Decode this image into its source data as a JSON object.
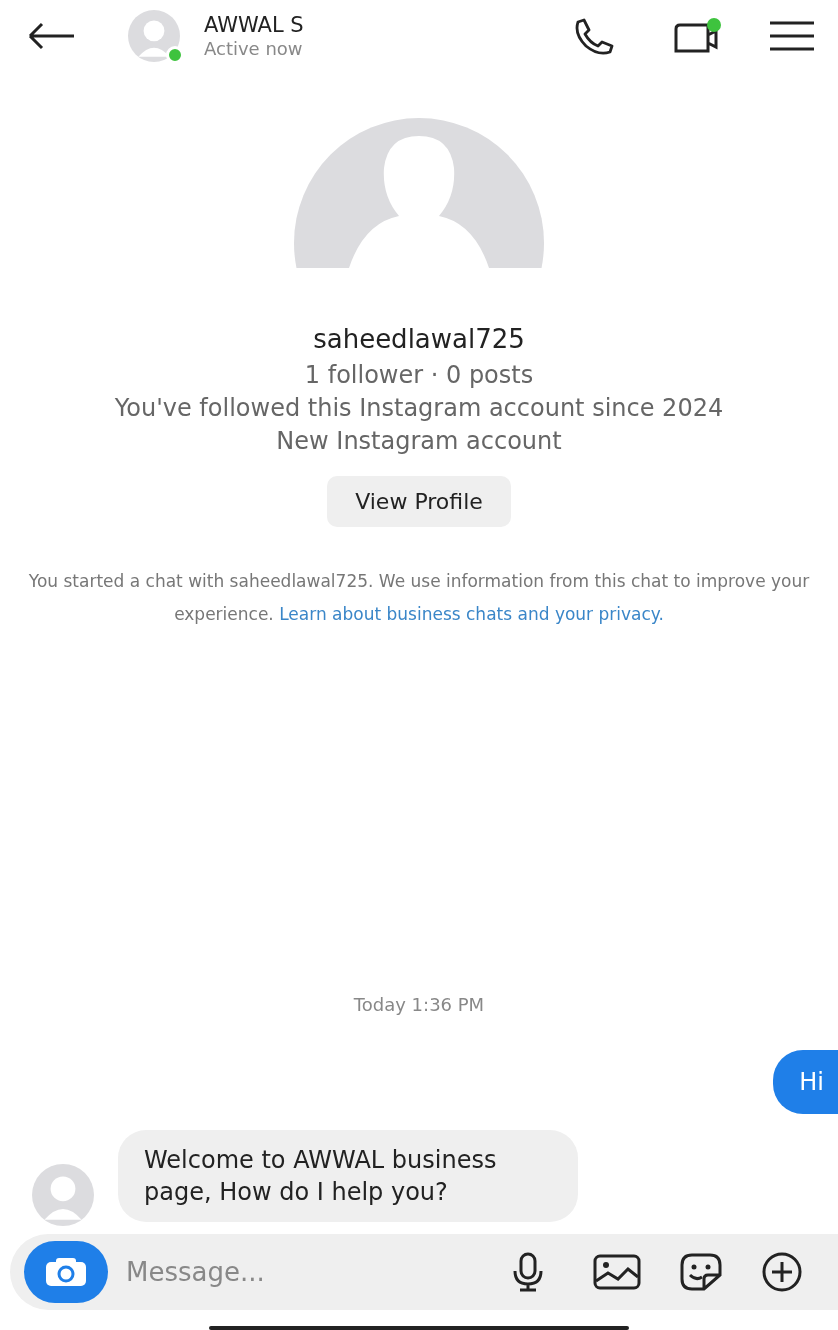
{
  "header": {
    "name": "AWWAL S",
    "status": "Active now",
    "active": true,
    "video_call_dot": true
  },
  "profile": {
    "username": "saheedlawal725",
    "stats": "1 follower · 0 posts",
    "lines": [
      "You've followed this Instagram account since 2024",
      "New Instagram account"
    ],
    "button": "View Profile"
  },
  "notice": {
    "text": "You started a chat with saheedlawal725. We use information from this chat to improve your experience.",
    "link": "Learn about business chats and your privacy."
  },
  "timestamp": "Today 1:36 PM",
  "messages": [
    {
      "kind": "outgoing",
      "text": "Hi"
    },
    {
      "kind": "incoming",
      "text": "Welcome to AWWAL business page, How do I help you?"
    }
  ],
  "composer": {
    "placeholder": "Message..."
  }
}
